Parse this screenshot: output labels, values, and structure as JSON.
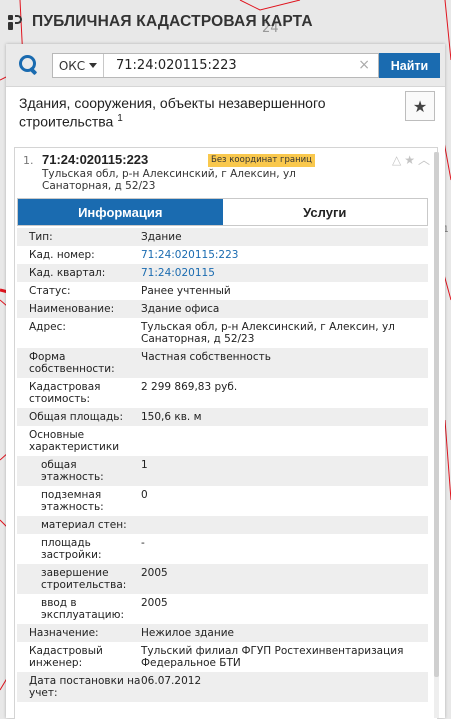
{
  "header": {
    "title": "ПУБЛИЧНАЯ КАДАСТРОВАЯ КАРТА"
  },
  "search": {
    "type_selected": "ОКС",
    "query": "71:24:020115:223",
    "clear_glyph": "×",
    "find_label": "Найти"
  },
  "results": {
    "title": "Здания, сооружения, объекты незавершенного строительства",
    "count": "1",
    "favorite_glyph": "★"
  },
  "card": {
    "number": "1.",
    "cadastral_number": "71:24:020115:223",
    "badge": "Без координат границ",
    "address": "Тульская обл, р-н Алексинский, г Алексин, ул Санаторная, д 52/23",
    "icons": {
      "warning": "△",
      "star": "★",
      "collapse": "︿"
    },
    "tabs": [
      {
        "label": "Информация",
        "active": true
      },
      {
        "label": "Услуги",
        "active": false
      }
    ]
  },
  "properties": [
    {
      "label": "Тип:",
      "value": "Здание"
    },
    {
      "label": "Кад. номер:",
      "value": "71:24:020115:223",
      "link": true
    },
    {
      "label": "Кад. квартал:",
      "value": "71:24:020115",
      "link": true
    },
    {
      "label": "Статус:",
      "value": "Ранее учтенный"
    },
    {
      "label": "Наименование:",
      "value": "Здание офиса"
    },
    {
      "label": "Адрес:",
      "value": "Тульская обл, р-н Алексинский, г Алексин, ул Санаторная, д 52/23"
    },
    {
      "label": "Форма собственности:",
      "value": "Частная собственность"
    },
    {
      "label": "Кадастровая стоимость:",
      "value": "2 299 869,83 руб."
    },
    {
      "label": "Общая площадь:",
      "value": "150,6 кв. м"
    },
    {
      "label": "Основные характеристики",
      "value": ""
    },
    {
      "label": "общая этажность:",
      "value": "1",
      "sub": true
    },
    {
      "label": "подземная этажность:",
      "value": "0",
      "sub": true
    },
    {
      "label": "материал стен:",
      "value": "",
      "sub": true
    },
    {
      "label": "площадь застройки:",
      "value": "-",
      "sub": true
    },
    {
      "label": "завершение строительства:",
      "value": "2005",
      "sub": true
    },
    {
      "label": "ввод в эксплуатацию:",
      "value": "2005",
      "sub": true
    },
    {
      "label": "Назначение:",
      "value": "Нежилое здание"
    },
    {
      "label": "Кадастровый инженер:",
      "value": "Тульский филиал ФГУП Ростехинвентаризация Федеральное БТИ"
    },
    {
      "label": "Дата постановки на учет:",
      "value": "06.07.2012"
    }
  ],
  "colors": {
    "accent": "#1a6bb0",
    "badge": "#f9c84d",
    "map_lines": "#e0141e"
  },
  "map": {
    "label_top": "24",
    "label_side": "1"
  }
}
